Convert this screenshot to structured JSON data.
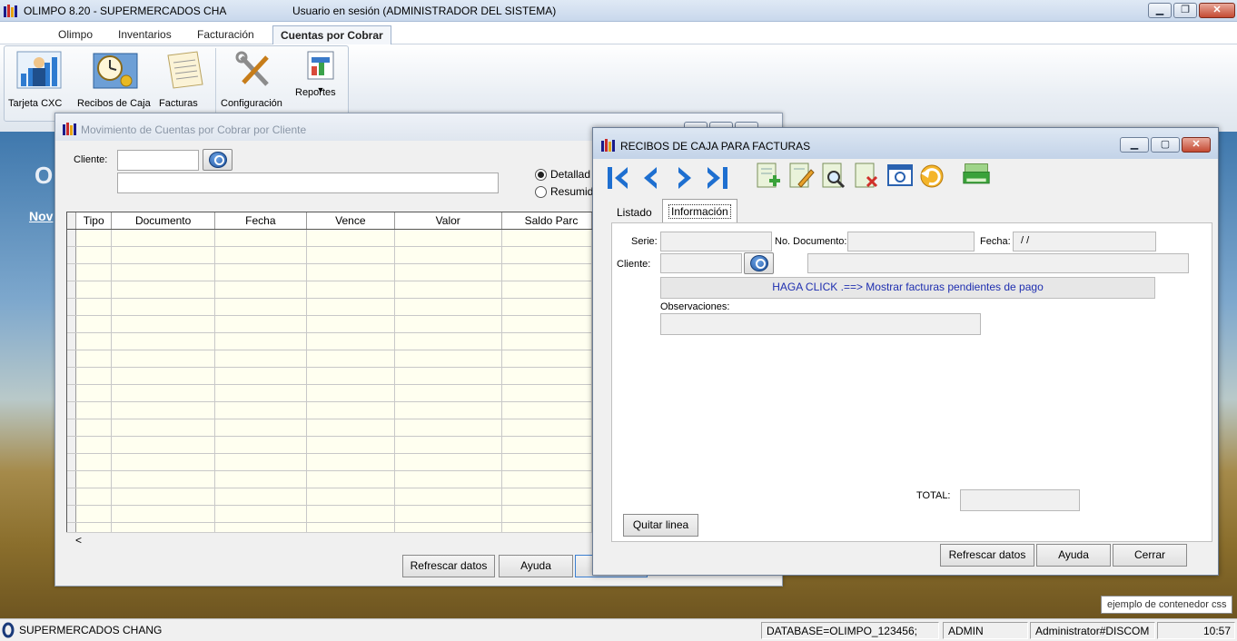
{
  "app": {
    "title": "OLIMPO 8.20 - SUPERMERCADOS CHA",
    "session": "Usuario en sesión (ADMINISTRADOR DEL SISTEMA)"
  },
  "menu": {
    "tabs": [
      "Olimpo",
      "Inventarios",
      "Facturación",
      "Cuentas por Cobrar"
    ],
    "active": "Cuentas por Cobrar"
  },
  "ribbon": {
    "buttons": [
      {
        "label": "Tarjeta CXC",
        "icon": "chart-person-icon"
      },
      {
        "label": "Recibos de Caja",
        "icon": "clock-cash-icon"
      },
      {
        "label": "Facturas",
        "icon": "invoice-icon"
      },
      {
        "label": "Configuración",
        "icon": "tools-icon"
      },
      {
        "label": "Reportes",
        "icon": "report-icon"
      }
    ]
  },
  "desktop": {
    "big_letter": "O",
    "link_text": "Nov"
  },
  "mov_window": {
    "title": "Movimiento de Cuentas por Cobrar por Cliente",
    "cliente_label": "Cliente:",
    "radio_detallado": "Detallad",
    "radio_resumido": "Resumid",
    "columns": [
      "Tipo",
      "Documento",
      "Fecha",
      "Vence",
      "Valor",
      "Saldo Parc"
    ],
    "scroll_left": "<",
    "buttons": {
      "refrescar": "Refrescar datos",
      "ayuda": "Ayuda"
    }
  },
  "rec_window": {
    "title": "RECIBOS DE CAJA PARA FACTURAS",
    "tabs": [
      "Listado",
      "Información"
    ],
    "active_tab": "Información",
    "serie_label": "Serie:",
    "nodoc_label": "No. Documento:",
    "fecha_label": "Fecha:",
    "fecha_value": " / /",
    "cliente_label": "Cliente:",
    "haga_click": "HAGA CLICK .==> Mostrar facturas pendientes de pago",
    "observaciones_label": "Observaciones:",
    "total_label": "TOTAL:",
    "quitar_linea": "Quitar linea",
    "buttons": {
      "refrescar": "Refrescar datos",
      "ayuda": "Ayuda",
      "cerrar": "Cerrar"
    },
    "toolbar": [
      "first-record-icon",
      "previous-record-icon",
      "next-record-icon",
      "last-record-icon",
      "add-document-icon",
      "edit-document-icon",
      "search-document-icon",
      "delete-document-icon",
      "refresh-window-icon",
      "undo-icon",
      "print-icon"
    ]
  },
  "tooltip": "ejemplo de contenedor css",
  "statusbar": {
    "company": "SUPERMERCADOS CHANG",
    "database": "DATABASE=OLIMPO_123456;",
    "user": "ADMIN",
    "machine": "Administrator#DISCOM",
    "time": "10:57"
  }
}
